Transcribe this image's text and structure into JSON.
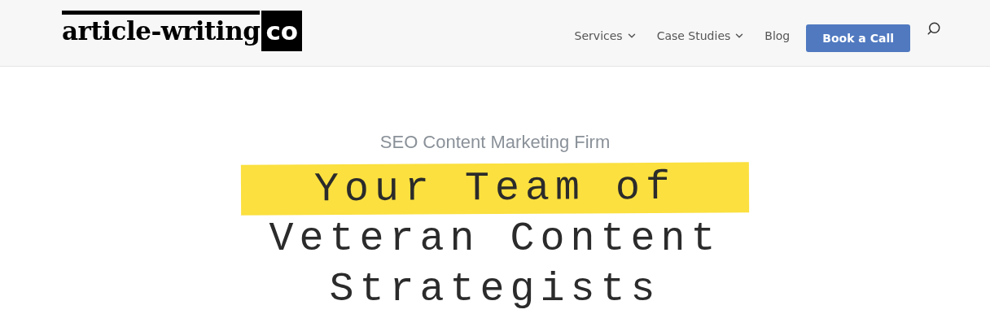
{
  "logo": {
    "text": "article-writing",
    "badge": "co"
  },
  "nav": [
    {
      "label": "Services",
      "kind": "dropdown"
    },
    {
      "label": "Case Studies",
      "kind": "dropdown"
    },
    {
      "label": "Blog",
      "kind": "link"
    },
    {
      "label": "Book a Call",
      "kind": "button"
    }
  ],
  "hero": {
    "eyebrow": "SEO Content Marketing Firm",
    "heading_lines": [
      {
        "text": "Your Team of",
        "highlighted": true
      },
      {
        "text": "Veteran Content",
        "highlighted": false
      },
      {
        "text": "Strategists",
        "highlighted": false
      }
    ]
  }
}
